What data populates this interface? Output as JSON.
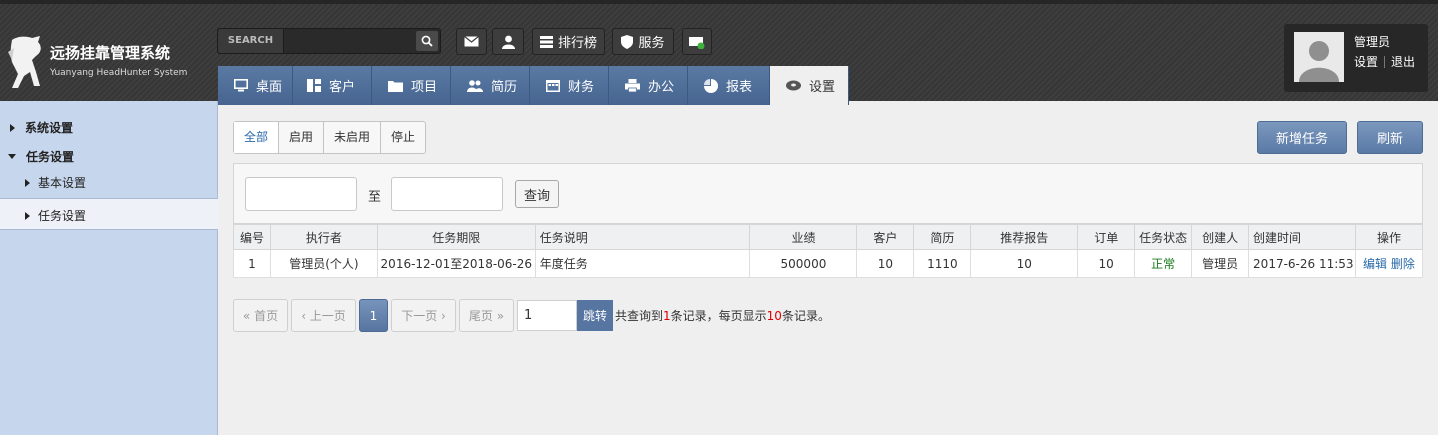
{
  "app": {
    "title": "远扬挂靠管理系统",
    "subtitle": "Yuanyang HeadHunter System"
  },
  "search": {
    "label": "SEARCH",
    "value": ""
  },
  "toolbar": {
    "ranking": "排行榜",
    "service": "服务"
  },
  "nav": {
    "tabs": [
      {
        "label": "桌面",
        "icon": "desktop-icon"
      },
      {
        "label": "客户",
        "icon": "customer-icon"
      },
      {
        "label": "项目",
        "icon": "folder-icon"
      },
      {
        "label": "简历",
        "icon": "people-icon"
      },
      {
        "label": "财务",
        "icon": "calendar-icon"
      },
      {
        "label": "办公",
        "icon": "printer-icon"
      },
      {
        "label": "报表",
        "icon": "pie-icon"
      },
      {
        "label": "设置",
        "icon": "settings-icon"
      }
    ],
    "active": "设置"
  },
  "user": {
    "name": "管理员",
    "settings": "设置",
    "logout": "退出"
  },
  "sidebar": {
    "items": [
      {
        "label": "系统设置",
        "expanded": false
      },
      {
        "label": "任务设置",
        "expanded": true
      },
      {
        "label": "基本设置"
      },
      {
        "label": "任务设置",
        "active": true
      }
    ]
  },
  "filter": {
    "tabs": [
      "全部",
      "启用",
      "未启用",
      "停止"
    ],
    "active": "全部"
  },
  "actions": {
    "add": "新增任务",
    "refresh": "刷新"
  },
  "dates": {
    "start": "",
    "to": "至",
    "end": "",
    "query": "查询"
  },
  "table": {
    "headers": [
      "编号",
      "执行者",
      "任务期限",
      "任务说明",
      "业绩",
      "客户",
      "简历",
      "推荐报告",
      "订单",
      "任务状态",
      "创建人",
      "创建时间",
      "操作"
    ],
    "rows": [
      {
        "id": "1",
        "executor": "管理员(个人)",
        "period": "2016-12-01至2018-06-26",
        "desc": "年度任务",
        "perf": "500000",
        "customers": "10",
        "resumes": "1110",
        "reports": "10",
        "orders": "10",
        "status": "正常",
        "creator": "管理员",
        "created": "2017-6-26 11:53",
        "edit": "编辑",
        "del": "删除"
      }
    ]
  },
  "pager": {
    "first": "« 首页",
    "prev": "‹ 上一页",
    "current": "1",
    "next": "下一页 ›",
    "last": "尾页 »",
    "input": "1",
    "go": "跳转",
    "info_pre": "共查询到",
    "total": "1",
    "info_mid": "条记录，每页显示",
    "per_page": "10",
    "info_post": "条记录。"
  },
  "colors": {
    "accent": "#5675a0",
    "sidebar": "#c6d6ec",
    "header": "#383838",
    "status_ok": "#1a7a1a"
  }
}
